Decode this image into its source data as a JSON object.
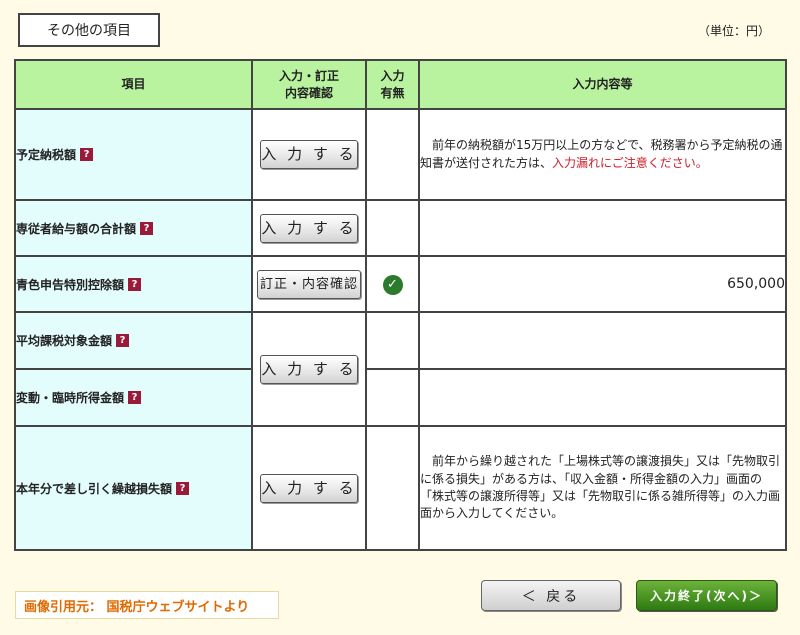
{
  "section_title": "その他の項目",
  "unit": "（単位：円）",
  "table": {
    "headers": {
      "item": "項目",
      "entry_line1": "入力・訂正",
      "entry_line2": "内容確認",
      "status_line1": "入力",
      "status_line2": "有無",
      "content": "入力内容等"
    },
    "help_mark": "?",
    "enter_label": "入 力 す る",
    "confirm_label": "訂正・内容確認",
    "check_mark": "✓",
    "rows": [
      {
        "label": "予定納税額",
        "content_before": "　前年の納税額が15万円以上の方などで、税務署から予定納税の通知書が送付された方は、",
        "content_red": "入力漏れにご注意ください。"
      },
      {
        "label": "専従者給与額の合計額"
      },
      {
        "label": "青色申告特別控除額",
        "value": "650,000",
        "entered": true
      },
      {
        "label": "平均課税対象金額"
      },
      {
        "label": "変動・臨時所得金額"
      },
      {
        "label": "本年分で差し引く繰越損失額",
        "content": "　前年から繰り越された「上場株式等の譲渡損失」又は「先物取引に係る損失」がある方は、「収入金額・所得金額の入力」画面の「株式等の譲渡所得等」又は「先物取引に係る雑所得等」の入力画面から入力してください。"
      }
    ]
  },
  "source_note": "画像引用元：  国税庁ウェブサイトより",
  "buttons": {
    "back": "＜ 戻る",
    "finish": "入力終了(次へ)＞"
  },
  "colors": {
    "page_bg": "#fffbe6",
    "header_bg": "#b9f3a0",
    "label_bg": "#e3fcfc",
    "help_icon": "#9a1a3a",
    "warning_text": "#d0202a",
    "finish_button": "#3f8a1e",
    "source_text": "#e06a00"
  },
  "icons": {
    "help": "question-mark-icon",
    "entered": "check-circle-icon"
  }
}
